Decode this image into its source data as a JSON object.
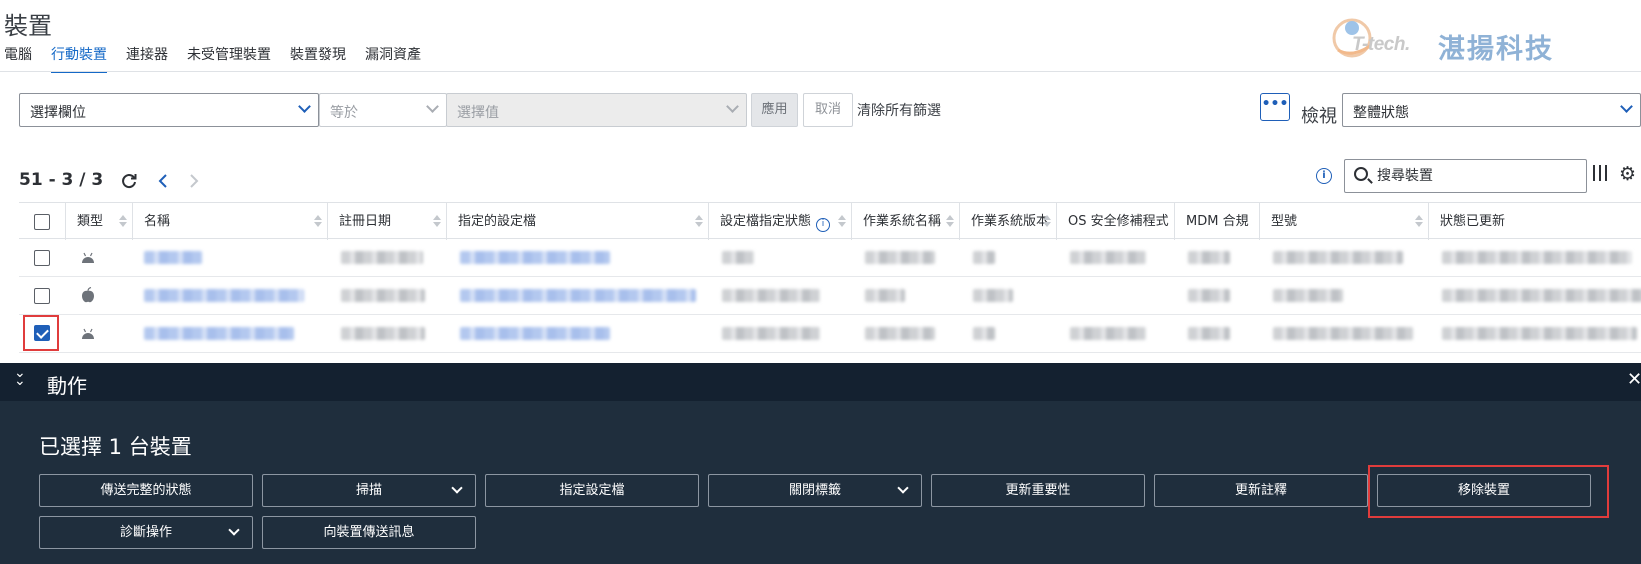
{
  "page": {
    "title": "裝置"
  },
  "tabs": [
    {
      "label": "電腦",
      "active": false
    },
    {
      "label": "行動裝置",
      "active": true
    },
    {
      "label": "連接器",
      "active": false
    },
    {
      "label": "未受管理裝置",
      "active": false
    },
    {
      "label": "裝置發現",
      "active": false
    },
    {
      "label": "漏洞資產",
      "active": false
    }
  ],
  "logo": {
    "tech_text": "T-tech.",
    "company_name": "湛揚科技"
  },
  "filter": {
    "field_select": "選擇欄位",
    "operator_select": "等於",
    "value_select": "選擇值",
    "apply_label": "應用",
    "cancel_label": "取消",
    "clear_all_label": "清除所有篩選",
    "more_label": "•••",
    "view_label": "檢視",
    "view_select": "整體狀態"
  },
  "toolbar": {
    "count_text": "51 - 3 / 3",
    "search_placeholder": "搜尋裝置"
  },
  "table": {
    "columns": [
      "類型",
      "名稱",
      "註冊日期",
      "指定的設定檔",
      "設定檔指定狀態",
      "作業系統名稱",
      "作業系統版本",
      "OS 安全修補程式",
      "MDM 合規",
      "型號",
      "狀態已更新"
    ],
    "rows": [
      {
        "type_icon": "android-icon",
        "checked": false
      },
      {
        "type_icon": "apple-icon",
        "checked": false
      },
      {
        "type_icon": "android-icon",
        "checked": true
      }
    ]
  },
  "actions": {
    "panel_title": "動作",
    "selected_text": "已選擇 1 台裝置",
    "buttons": [
      {
        "label": "傳送完整的狀態",
        "dropdown": false
      },
      {
        "label": "掃描",
        "dropdown": true
      },
      {
        "label": "指定設定檔",
        "dropdown": false
      },
      {
        "label": "關閉標籤",
        "dropdown": true
      },
      {
        "label": "更新重要性",
        "dropdown": false
      },
      {
        "label": "更新註釋",
        "dropdown": false
      },
      {
        "label": "移除裝置",
        "dropdown": false
      },
      {
        "label": "診斷操作",
        "dropdown": true
      },
      {
        "label": "向裝置傳送訊息",
        "dropdown": false
      }
    ]
  },
  "colors": {
    "accent": "#1569c7",
    "panel_bg": "#1f2e3d",
    "highlight": "#e03c3c"
  }
}
